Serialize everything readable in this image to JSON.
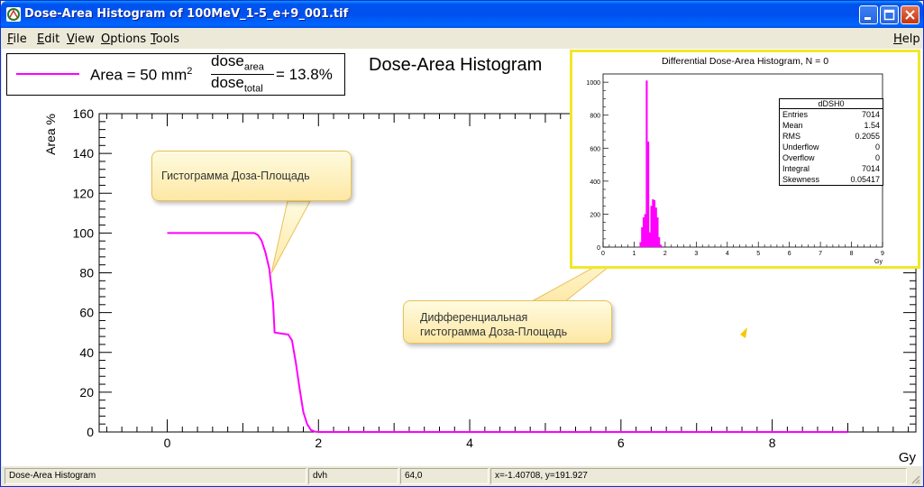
{
  "window": {
    "title": "Dose-Area Histogram of 100MeV_1-5_e+9_001.tif",
    "minimize_label": "minimize",
    "maximize_label": "maximize",
    "close_label": "close"
  },
  "menu": {
    "items": [
      {
        "label": "File",
        "mnemonic": "F",
        "rest": "ile"
      },
      {
        "label": "Edit",
        "mnemonic": "E",
        "rest": "dit"
      },
      {
        "label": "View",
        "mnemonic": "V",
        "rest": "iew"
      },
      {
        "label": "Options",
        "mnemonic": "O",
        "rest": "ptions"
      },
      {
        "label": "Tools",
        "mnemonic": "T",
        "rest": "ools"
      }
    ],
    "help": {
      "label": "Help",
      "mnemonic": "H",
      "rest": "elp"
    }
  },
  "legend": {
    "prefix": "Area = 50 mm",
    "sup": "2",
    "numerator": "dose",
    "numerator_sub": "area",
    "denominator": "dose",
    "denominator_sub": "total",
    "suffix": "= 13.8%",
    "line_color": "#ff00ff"
  },
  "callouts": {
    "first": "Гистограмма Доза-Площадь",
    "second_line1": "Дифференциальная",
    "second_line2": "гистограмма Доза-Площадь"
  },
  "chart_data": [
    {
      "type": "line",
      "title": "Dose-Area Histogram",
      "xlabel": "Gy",
      "ylabel": "Area %",
      "xlim": [
        -0.9,
        9.9
      ],
      "ylim": [
        0,
        160
      ],
      "xticks": [
        "0",
        "2",
        "4",
        "6",
        "8"
      ],
      "yticks": [
        "0",
        "20",
        "40",
        "60",
        "80",
        "100",
        "120",
        "140",
        "160"
      ],
      "grid": false,
      "series": [
        {
          "color": "#ff00ff",
          "x": [
            0,
            1.15,
            1.2,
            1.25,
            1.3,
            1.35,
            1.4,
            1.42,
            1.5,
            1.6,
            1.65,
            1.7,
            1.75,
            1.8,
            1.85,
            1.9,
            1.95,
            2.0,
            5.0,
            9.0
          ],
          "y": [
            100,
            100,
            99,
            96,
            90,
            82,
            65,
            50,
            49.5,
            49,
            46,
            35,
            22,
            10,
            4,
            1,
            0.2,
            0,
            0,
            0
          ]
        }
      ]
    },
    {
      "type": "bar",
      "title": "Differential Dose-Area Histogram, N = 0",
      "xlabel": "Gy",
      "xlim": [
        0,
        9
      ],
      "ylim": [
        0,
        1050
      ],
      "xticks": [
        "0",
        "1",
        "2",
        "3",
        "4",
        "5",
        "6",
        "7",
        "8",
        "9"
      ],
      "yticks": [
        "0",
        "200",
        "400",
        "600",
        "800",
        "1000"
      ],
      "color": "#ff00ff",
      "bins": [
        {
          "x": 1.2,
          "y": 30
        },
        {
          "x": 1.25,
          "y": 120
        },
        {
          "x": 1.3,
          "y": 180
        },
        {
          "x": 1.35,
          "y": 200
        },
        {
          "x": 1.4,
          "y": 1010
        },
        {
          "x": 1.45,
          "y": 640
        },
        {
          "x": 1.5,
          "y": 90
        },
        {
          "x": 1.55,
          "y": 250
        },
        {
          "x": 1.6,
          "y": 290
        },
        {
          "x": 1.65,
          "y": 285
        },
        {
          "x": 1.7,
          "y": 240
        },
        {
          "x": 1.75,
          "y": 180
        },
        {
          "x": 1.8,
          "y": 60
        },
        {
          "x": 1.85,
          "y": 15
        },
        {
          "x": 1.9,
          "y": 5
        }
      ],
      "stats": {
        "name": "dDSH0",
        "rows": [
          {
            "k": "Entries",
            "v": "7014"
          },
          {
            "k": "Mean",
            "v": "1.54"
          },
          {
            "k": "RMS",
            "v": "0.2055"
          },
          {
            "k": "Underflow",
            "v": "0"
          },
          {
            "k": "Overflow",
            "v": "0"
          },
          {
            "k": "Integral",
            "v": "7014"
          },
          {
            "k": "Skewness",
            "v": "0.05417"
          }
        ]
      }
    }
  ],
  "status": {
    "cell1": "Dose-Area Histogram",
    "cell2": "dvh",
    "cell3": "64,0",
    "cell4": "x=-1.40708, y=191.927"
  },
  "colors": {
    "accent": "#ff00ff",
    "title_bar": "#0053ee",
    "inset_border": "#f0e82a"
  }
}
